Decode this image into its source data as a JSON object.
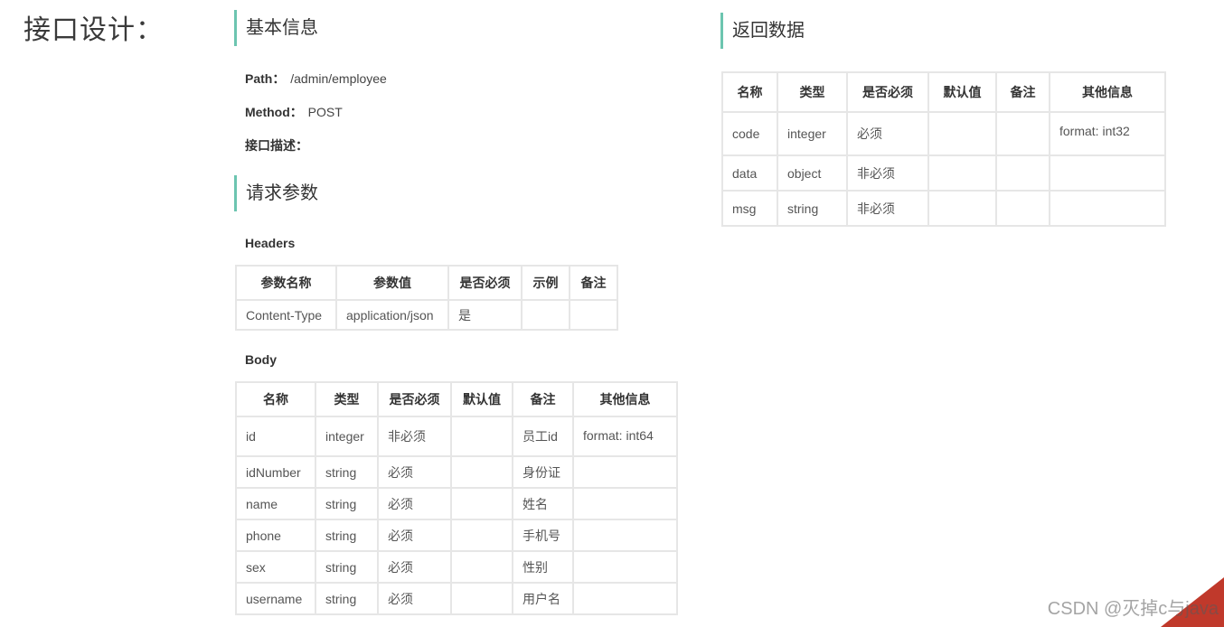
{
  "page_title": "接口设计：",
  "basic": {
    "heading": "基本信息",
    "path_label": "Path：",
    "path_value": "/admin/employee",
    "method_label": "Method：",
    "method_value": "POST",
    "desc_label": "接口描述："
  },
  "request": {
    "heading": "请求参数",
    "headers_label": "Headers",
    "headers_columns": [
      "参数名称",
      "参数值",
      "是否必须",
      "示例",
      "备注"
    ],
    "headers_rows": [
      [
        "Content-Type",
        "application/json",
        "是",
        "",
        ""
      ]
    ],
    "body_label": "Body",
    "body_columns": [
      "名称",
      "类型",
      "是否必须",
      "默认值",
      "备注",
      "其他信息"
    ],
    "body_rows": [
      [
        "id",
        "integer",
        "非必须",
        "",
        "员工id",
        "format: int64"
      ],
      [
        "idNumber",
        "string",
        "必须",
        "",
        "身份证",
        ""
      ],
      [
        "name",
        "string",
        "必须",
        "",
        "姓名",
        ""
      ],
      [
        "phone",
        "string",
        "必须",
        "",
        "手机号",
        ""
      ],
      [
        "sex",
        "string",
        "必须",
        "",
        "性别",
        ""
      ],
      [
        "username",
        "string",
        "必须",
        "",
        "用户名",
        ""
      ]
    ]
  },
  "response": {
    "heading": "返回数据",
    "columns": [
      "名称",
      "类型",
      "是否必须",
      "默认值",
      "备注",
      "其他信息"
    ],
    "rows": [
      [
        "code",
        "integer",
        "必须",
        "",
        "",
        "format: int32"
      ],
      [
        "data",
        "object",
        "非必须",
        "",
        "",
        ""
      ],
      [
        "msg",
        "string",
        "非必须",
        "",
        "",
        ""
      ]
    ]
  },
  "watermark": "CSDN @灭掉c与java"
}
